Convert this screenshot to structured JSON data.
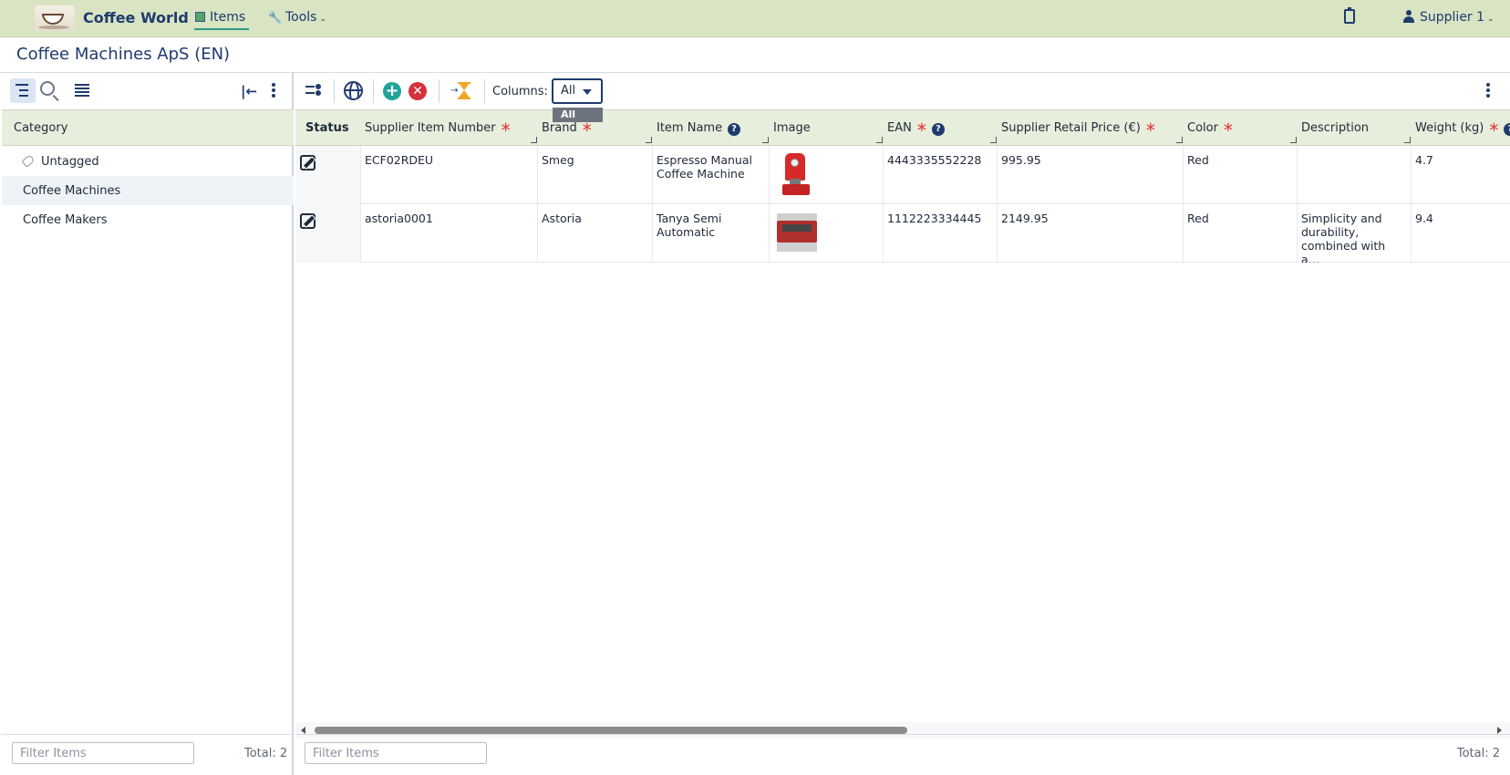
{
  "app": {
    "brand": "Coffee World",
    "nav": {
      "items_label": "Items",
      "tools_label": "Tools"
    },
    "user_label": "Supplier 1"
  },
  "page_title": "Coffee Machines ApS (EN)",
  "left_panel": {
    "header": "Category",
    "categories": [
      {
        "label": "Untagged"
      },
      {
        "label": "Coffee Machines",
        "selected": true
      },
      {
        "label": "Coffee Makers"
      }
    ],
    "filter_placeholder": "Filter Items",
    "total": "Total: 2"
  },
  "toolbar": {
    "columns_label": "Columns:",
    "columns_value": "All",
    "columns_options": [
      "All"
    ]
  },
  "grid": {
    "columns": [
      {
        "label": "Status"
      },
      {
        "label": "Supplier Item Number",
        "required": true
      },
      {
        "label": "Brand",
        "required": true
      },
      {
        "label": "Item Name",
        "help": true
      },
      {
        "label": "Image"
      },
      {
        "label": "EAN",
        "required": true,
        "help": true
      },
      {
        "label": "Supplier Retail Price (€)",
        "required": true
      },
      {
        "label": "Color",
        "required": true
      },
      {
        "label": "Description"
      },
      {
        "label": "Weight (kg)",
        "required": true,
        "help": true
      }
    ],
    "rows": [
      {
        "supplier_item_number": "ECF02RDEU",
        "brand": "Smeg",
        "item_name": "Espresso Manual Coffee Machine",
        "image": "espresso-machine-image",
        "ean": "4443335552228",
        "price": "995.95",
        "color": "Red",
        "description": "",
        "weight": "4.7"
      },
      {
        "supplier_item_number": "astoria0001",
        "brand": "Astoria",
        "item_name": "Tanya Semi Automatic",
        "image": "astoria-machine-image",
        "ean": "1112223334445",
        "price": "2149.95",
        "color": "Red",
        "description": "Simplicity and durability, combined with a…",
        "weight": "9.4"
      }
    ],
    "filter_placeholder": "Filter Items",
    "total": "Total: 2"
  },
  "colors": {
    "nav_bg": "#d9e4c3",
    "header_bg": "#e8eedc",
    "accent": "#1f3b6e",
    "required": "#e52b2b",
    "add": "#1fa49a",
    "remove": "#d6303a"
  }
}
